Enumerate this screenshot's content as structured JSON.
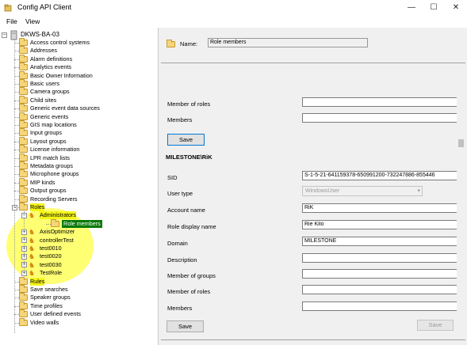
{
  "window": {
    "title": "Config API Client",
    "minimize": "—",
    "maximize": "☐",
    "close": "✕"
  },
  "menu": {
    "file": "File",
    "view": "View"
  },
  "tree": {
    "root": "DKWS-BA-03",
    "items": [
      "Access control systems",
      "Addresses",
      "Alarm definitions",
      "Analytics events",
      "Basic Owner Information",
      "Basic users",
      "Camera groups",
      "Child sites",
      "Generic event data sources",
      "Generic events",
      "GIS map locations",
      "Input groups",
      "Layout groups",
      "License information",
      "LPR match lists",
      "Metadata groups",
      "Microphone groups",
      "MIP kinds",
      "Output groups",
      "Recording Servers"
    ],
    "roles": "Roles",
    "administrators": "Administrators",
    "role_members": "Role members",
    "role_children": [
      "AxisOptimizer",
      "controllerTest",
      "test0010",
      "test0020",
      "test0030",
      "TestRole"
    ],
    "after_roles": [
      "Rules",
      "Save searches",
      "Speaker groups",
      "Time profiles",
      "User defined events",
      "Video walls"
    ]
  },
  "detail": {
    "name_label": "Name:",
    "name_value": "Role members",
    "top": {
      "member_of_roles": "Member of roles",
      "members": "Members",
      "save": "Save"
    },
    "user_title": "MILESTONE\\RiK",
    "fields": {
      "sid_label": "SID",
      "sid_value": "S-1-5-21-641159378-650991200-732247886-855446",
      "user_type_label": "User type",
      "user_type_value": "WindowsUser",
      "account_name_label": "Account name",
      "account_name_value": "RiK",
      "role_display_name_label": "Role display name",
      "role_display_name_value": "Rie Kito",
      "domain_label": "Domain",
      "domain_value": "MILESTONE",
      "description_label": "Description",
      "member_of_groups_label": "Member of groups",
      "member_of_roles_label": "Member of roles",
      "members_label": "Members",
      "save": "Save"
    },
    "bottom_save": "Save"
  },
  "colors": {
    "highlight": "#f4f41a",
    "selected": "#0a7a0a",
    "focus": "#0078d7"
  }
}
